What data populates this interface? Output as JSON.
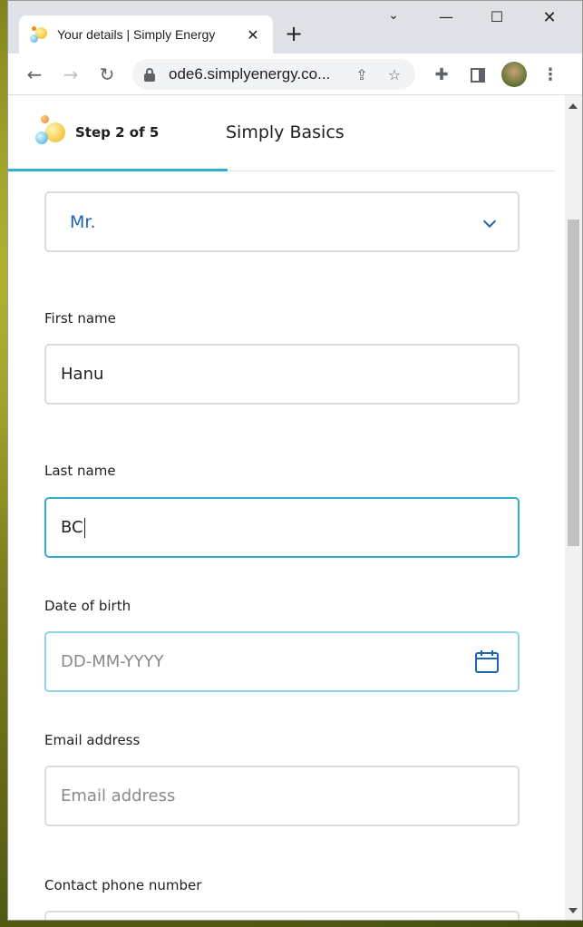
{
  "browser": {
    "tab_title": "Your details | Simply Energy",
    "new_tab_symbol": "+",
    "url": "ode6.simplyenergy.co...",
    "window_controls": {
      "minimize": "—",
      "maximize": "☐",
      "close": "✕",
      "tab_list": "⌄"
    }
  },
  "steps": {
    "step_label": "Step 2 of 5",
    "plan_name": "Simply Basics"
  },
  "form": {
    "title_select": {
      "value": "Mr."
    },
    "first_name": {
      "label": "First name",
      "value": "Hanu"
    },
    "last_name": {
      "label": "Last name",
      "value": "BC"
    },
    "dob": {
      "label": "Date of birth",
      "placeholder": "DD-MM-YYYY"
    },
    "email": {
      "label": "Email address",
      "placeholder": "Email address"
    },
    "phone": {
      "label": "Contact phone number"
    }
  },
  "colors": {
    "accent": "#2eaed0",
    "link_blue": "#1e64b0",
    "border": "#dcdcdc"
  }
}
